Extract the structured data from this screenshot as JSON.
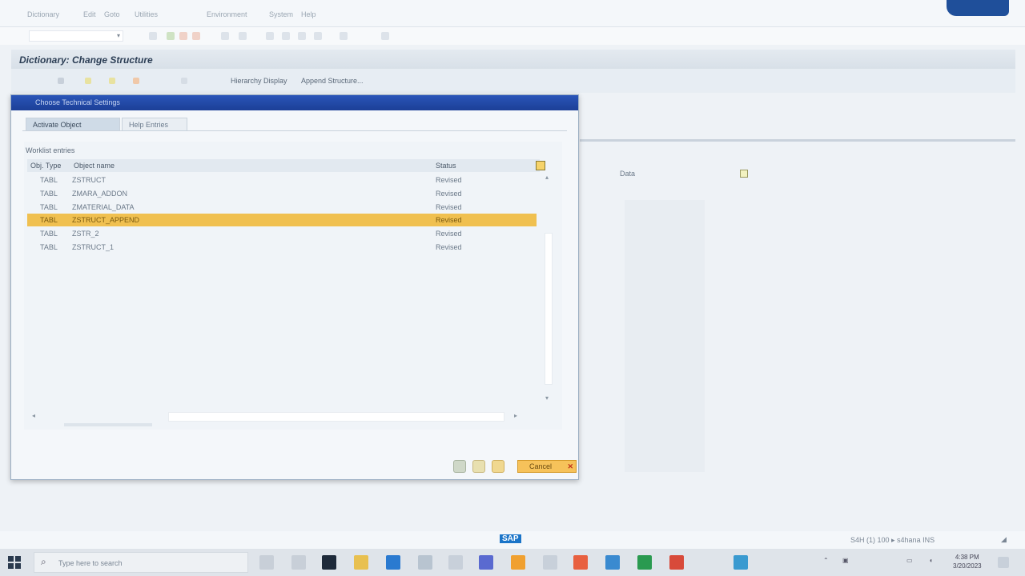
{
  "menubar": {
    "items": [
      "Dictionary",
      "Edit",
      "Goto",
      "Utilities",
      "Environment",
      "System",
      "Help"
    ]
  },
  "window": {
    "title": "Dictionary: Change Structure"
  },
  "app_toolbar": {
    "buttons": [
      "Hierarchy Display",
      "Append Structure..."
    ]
  },
  "background": {
    "field_label": "Data"
  },
  "dialog": {
    "title": "Choose Technical Settings",
    "tabs": [
      "Activate Object",
      "Help Entries"
    ],
    "group_label": "Worklist entries",
    "columns": {
      "object": "Obj. Type",
      "name": "Object name",
      "status": "Status"
    },
    "rows": [
      {
        "type": "TABL",
        "name": "ZSTRUCT",
        "status": "Revised"
      },
      {
        "type": "TABL",
        "name": "ZMARA_ADDON",
        "status": "Revised"
      },
      {
        "type": "TABL",
        "name": "ZMATERIAL_DATA",
        "status": "Revised"
      },
      {
        "type": "TABL",
        "name": "ZSTRUCT_APPEND",
        "status": "Revised"
      },
      {
        "type": "TABL",
        "name": "ZSTR_2",
        "status": "Revised"
      },
      {
        "type": "TABL",
        "name": "ZSTRUCT_1",
        "status": "Revised"
      }
    ],
    "selected_row": 3,
    "cancel_label": "Cancel"
  },
  "statusbar": {
    "sap_logo": "SAP",
    "system_info": "S4H (1) 100 ▸ s4hana  INS"
  },
  "taskbar": {
    "search_placeholder": "Type here to search",
    "clock_time": "4:38 PM",
    "clock_date": "3/20/2023"
  },
  "colors": {
    "dialog_title_bg": "#1c3f97",
    "selected_row": "#f0c050",
    "sap_blue": "#1a74c8"
  }
}
